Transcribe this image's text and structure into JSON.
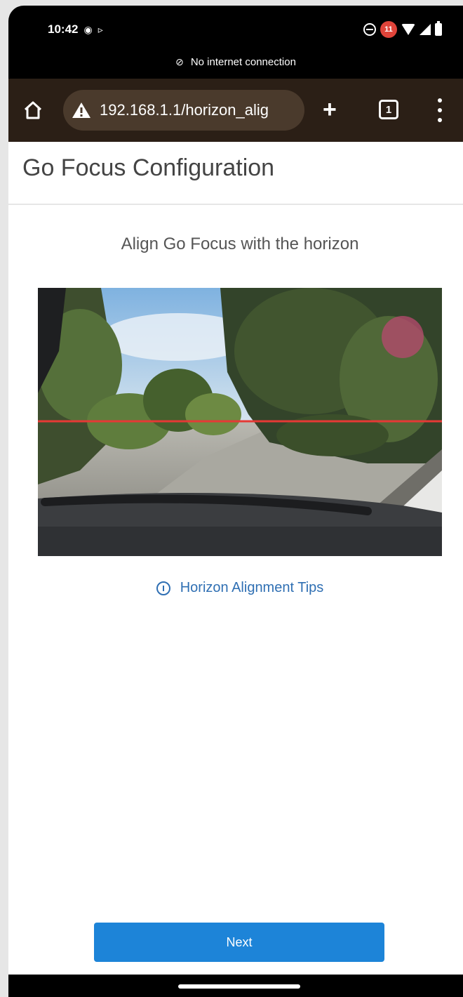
{
  "status_bar": {
    "time": "10:42",
    "notification_count": "11",
    "icons": [
      "record-icon",
      "cast-icon",
      "do-not-disturb-icon",
      "notification-badge",
      "wifi-icon",
      "signal-icon",
      "battery-icon"
    ]
  },
  "connection_notice": "No internet connection",
  "browser": {
    "url": "192.168.1.1/horizon_alig",
    "tab_count": "1",
    "icons": [
      "home-icon",
      "warning-icon",
      "plus-icon",
      "tabs-icon",
      "menu-icon"
    ]
  },
  "page": {
    "title": "Go Focus Configuration",
    "instruction": "Align Go Focus with the horizon",
    "tips_link": "Horizon Alignment Tips",
    "next_button": "Next"
  },
  "colors": {
    "toolbar": "#2b1f16",
    "url_bar": "#4a3a2c",
    "link": "#2f6fb3",
    "button": "#1d84d8",
    "horizon_line": "#e53935"
  }
}
